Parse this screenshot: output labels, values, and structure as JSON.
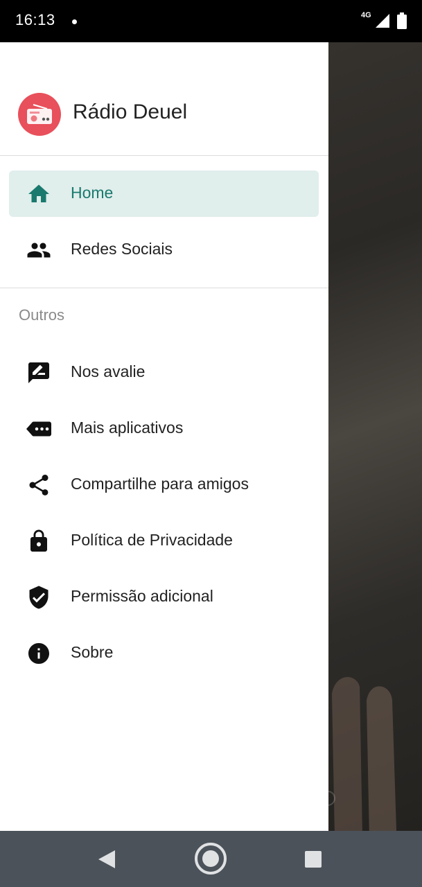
{
  "status_bar": {
    "time": "16:13",
    "network": "4G"
  },
  "app": {
    "name": "Rádio Deuel",
    "accent_color": "#1a7a6e",
    "logo_color": "#e8505b"
  },
  "menu": {
    "primary_items": [
      {
        "label": "Home",
        "icon": "home-icon",
        "active": true
      },
      {
        "label": "Redes Sociais",
        "icon": "people-icon",
        "active": false
      }
    ],
    "section_title": "Outros",
    "other_items": [
      {
        "label": "Nos avalie",
        "icon": "rate-review-icon"
      },
      {
        "label": "Mais aplicativos",
        "icon": "more-apps-icon"
      },
      {
        "label": "Compartilhe para amigos",
        "icon": "share-icon"
      },
      {
        "label": "Política de Privacidade",
        "icon": "lock-icon"
      },
      {
        "label": "Permissão adicional",
        "icon": "shield-check-icon"
      },
      {
        "label": "Sobre",
        "icon": "info-icon"
      }
    ]
  },
  "system_nav": {
    "back": "back-icon",
    "home": "home-button-icon",
    "recents": "recents-icon"
  }
}
